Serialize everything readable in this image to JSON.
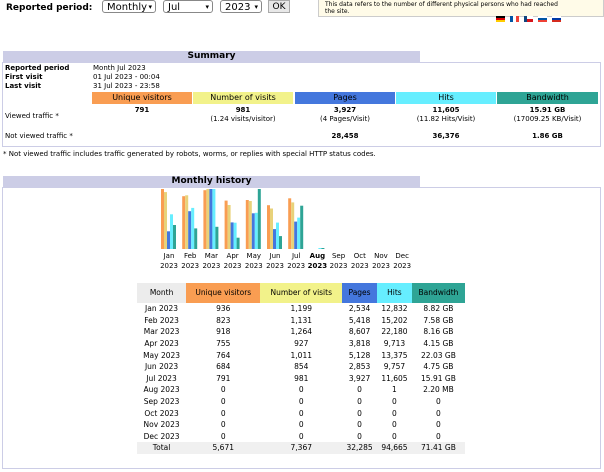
{
  "header": {
    "reported_period_label": "Reported period:",
    "month_value": "Monthly",
    "month_select": "Jul",
    "year_select": "2023",
    "ok_label": "OK",
    "info_line1": "This data refers to the number of different physical persons who had reached",
    "info_line2": "the site."
  },
  "summary": {
    "title": "Summary",
    "reported_period_label": "Reported period",
    "reported_period_value": "Month Jul 2023",
    "first_visit_label": "First visit",
    "first_visit_value": "01 Jul 2023 - 00:04",
    "last_visit_label": "Last visit",
    "last_visit_value": "31 Jul 2023 - 23:58",
    "columns": [
      "Unique visitors",
      "Number of visits",
      "Pages",
      "Hits",
      "Bandwidth"
    ],
    "column_colors": [
      "#f99d52",
      "#f2f28a",
      "#4477dd",
      "#66eeff",
      "#2ea495"
    ],
    "viewed_label": "Viewed traffic *",
    "viewed": {
      "unique": "791",
      "visits": "981",
      "visits_sub": "(1.24 visits/visitor)",
      "pages": "3,927",
      "pages_sub": "(4 Pages/Visit)",
      "hits": "11,605",
      "hits_sub": "(11.82 Hits/Visit)",
      "bandwidth": "15.91 GB",
      "bandwidth_sub": "(17009.25 KB/Visit)"
    },
    "not_viewed_label": "Not viewed traffic *",
    "not_viewed": {
      "pages": "28,458",
      "hits": "36,376",
      "bandwidth": "1.86 GB"
    },
    "footnote": "* Not viewed traffic includes traffic generated by robots, worms, or replies with special HTTP status codes."
  },
  "monthly": {
    "title": "Monthly history",
    "table_headers": [
      "Month",
      "Unique visitors",
      "Number of visits",
      "Pages",
      "Hits",
      "Bandwidth"
    ],
    "rows": [
      [
        "Jan 2023",
        "936",
        "1,199",
        "2,534",
        "12,832",
        "8.82 GB"
      ],
      [
        "Feb 2023",
        "823",
        "1,131",
        "5,418",
        "15,202",
        "7.58 GB"
      ],
      [
        "Mar 2023",
        "918",
        "1,264",
        "8,607",
        "22,180",
        "8.16 GB"
      ],
      [
        "Apr 2023",
        "755",
        "927",
        "3,818",
        "9,713",
        "4.15 GB"
      ],
      [
        "May 2023",
        "764",
        "1,011",
        "5,128",
        "13,375",
        "22.03 GB"
      ],
      [
        "Jun 2023",
        "684",
        "854",
        "2,853",
        "9,757",
        "4.75 GB"
      ],
      [
        "Jul 2023",
        "791",
        "981",
        "3,927",
        "11,605",
        "15.91 GB"
      ],
      [
        "Aug 2023",
        "0",
        "0",
        "0",
        "1",
        "2.20 MB"
      ],
      [
        "Sep 2023",
        "0",
        "0",
        "0",
        "0",
        "0"
      ],
      [
        "Oct 2023",
        "0",
        "0",
        "0",
        "0",
        "0"
      ],
      [
        "Nov 2023",
        "0",
        "0",
        "0",
        "0",
        "0"
      ],
      [
        "Dec 2023",
        "0",
        "0",
        "0",
        "0",
        "0"
      ]
    ],
    "total": [
      "Total",
      "5,671",
      "7,367",
      "32,285",
      "94,665",
      "71.41 GB"
    ]
  },
  "chart_data": {
    "type": "bar",
    "categories": [
      "Jan 2023",
      "Feb 2023",
      "Mar 2023",
      "Apr 2023",
      "May 2023",
      "Jun 2023",
      "Jul 2023",
      "Aug 2023",
      "Sep 2023",
      "Oct 2023",
      "Nov 2023",
      "Dec 2023"
    ],
    "month_labels": [
      "Jan",
      "Feb",
      "Mar",
      "Apr",
      "May",
      "Jun",
      "Jul",
      "Aug",
      "Sep",
      "Oct",
      "Nov",
      "Dec"
    ],
    "year_label": "2023",
    "series": [
      {
        "name": "Unique visitors",
        "color": "#f99d52",
        "values": [
          936,
          823,
          918,
          755,
          764,
          684,
          791,
          0,
          0,
          0,
          0,
          0
        ]
      },
      {
        "name": "Number of visits",
        "color": "#e8d27a",
        "values": [
          1199,
          1131,
          1264,
          927,
          1011,
          854,
          981,
          0,
          0,
          0,
          0,
          0
        ]
      },
      {
        "name": "Pages",
        "color": "#4477dd",
        "values": [
          2534,
          5418,
          8607,
          3818,
          5128,
          2853,
          3927,
          0,
          0,
          0,
          0,
          0
        ]
      },
      {
        "name": "Hits",
        "color": "#66eeff",
        "values": [
          12832,
          15202,
          22180,
          9713,
          13375,
          9757,
          11605,
          1,
          0,
          0,
          0,
          0
        ]
      },
      {
        "name": "Bandwidth",
        "color": "#2ea495",
        "values": [
          8.82,
          7.58,
          8.16,
          4.15,
          22.03,
          4.75,
          15.91,
          0.0022,
          0,
          0,
          0,
          0
        ]
      }
    ]
  }
}
